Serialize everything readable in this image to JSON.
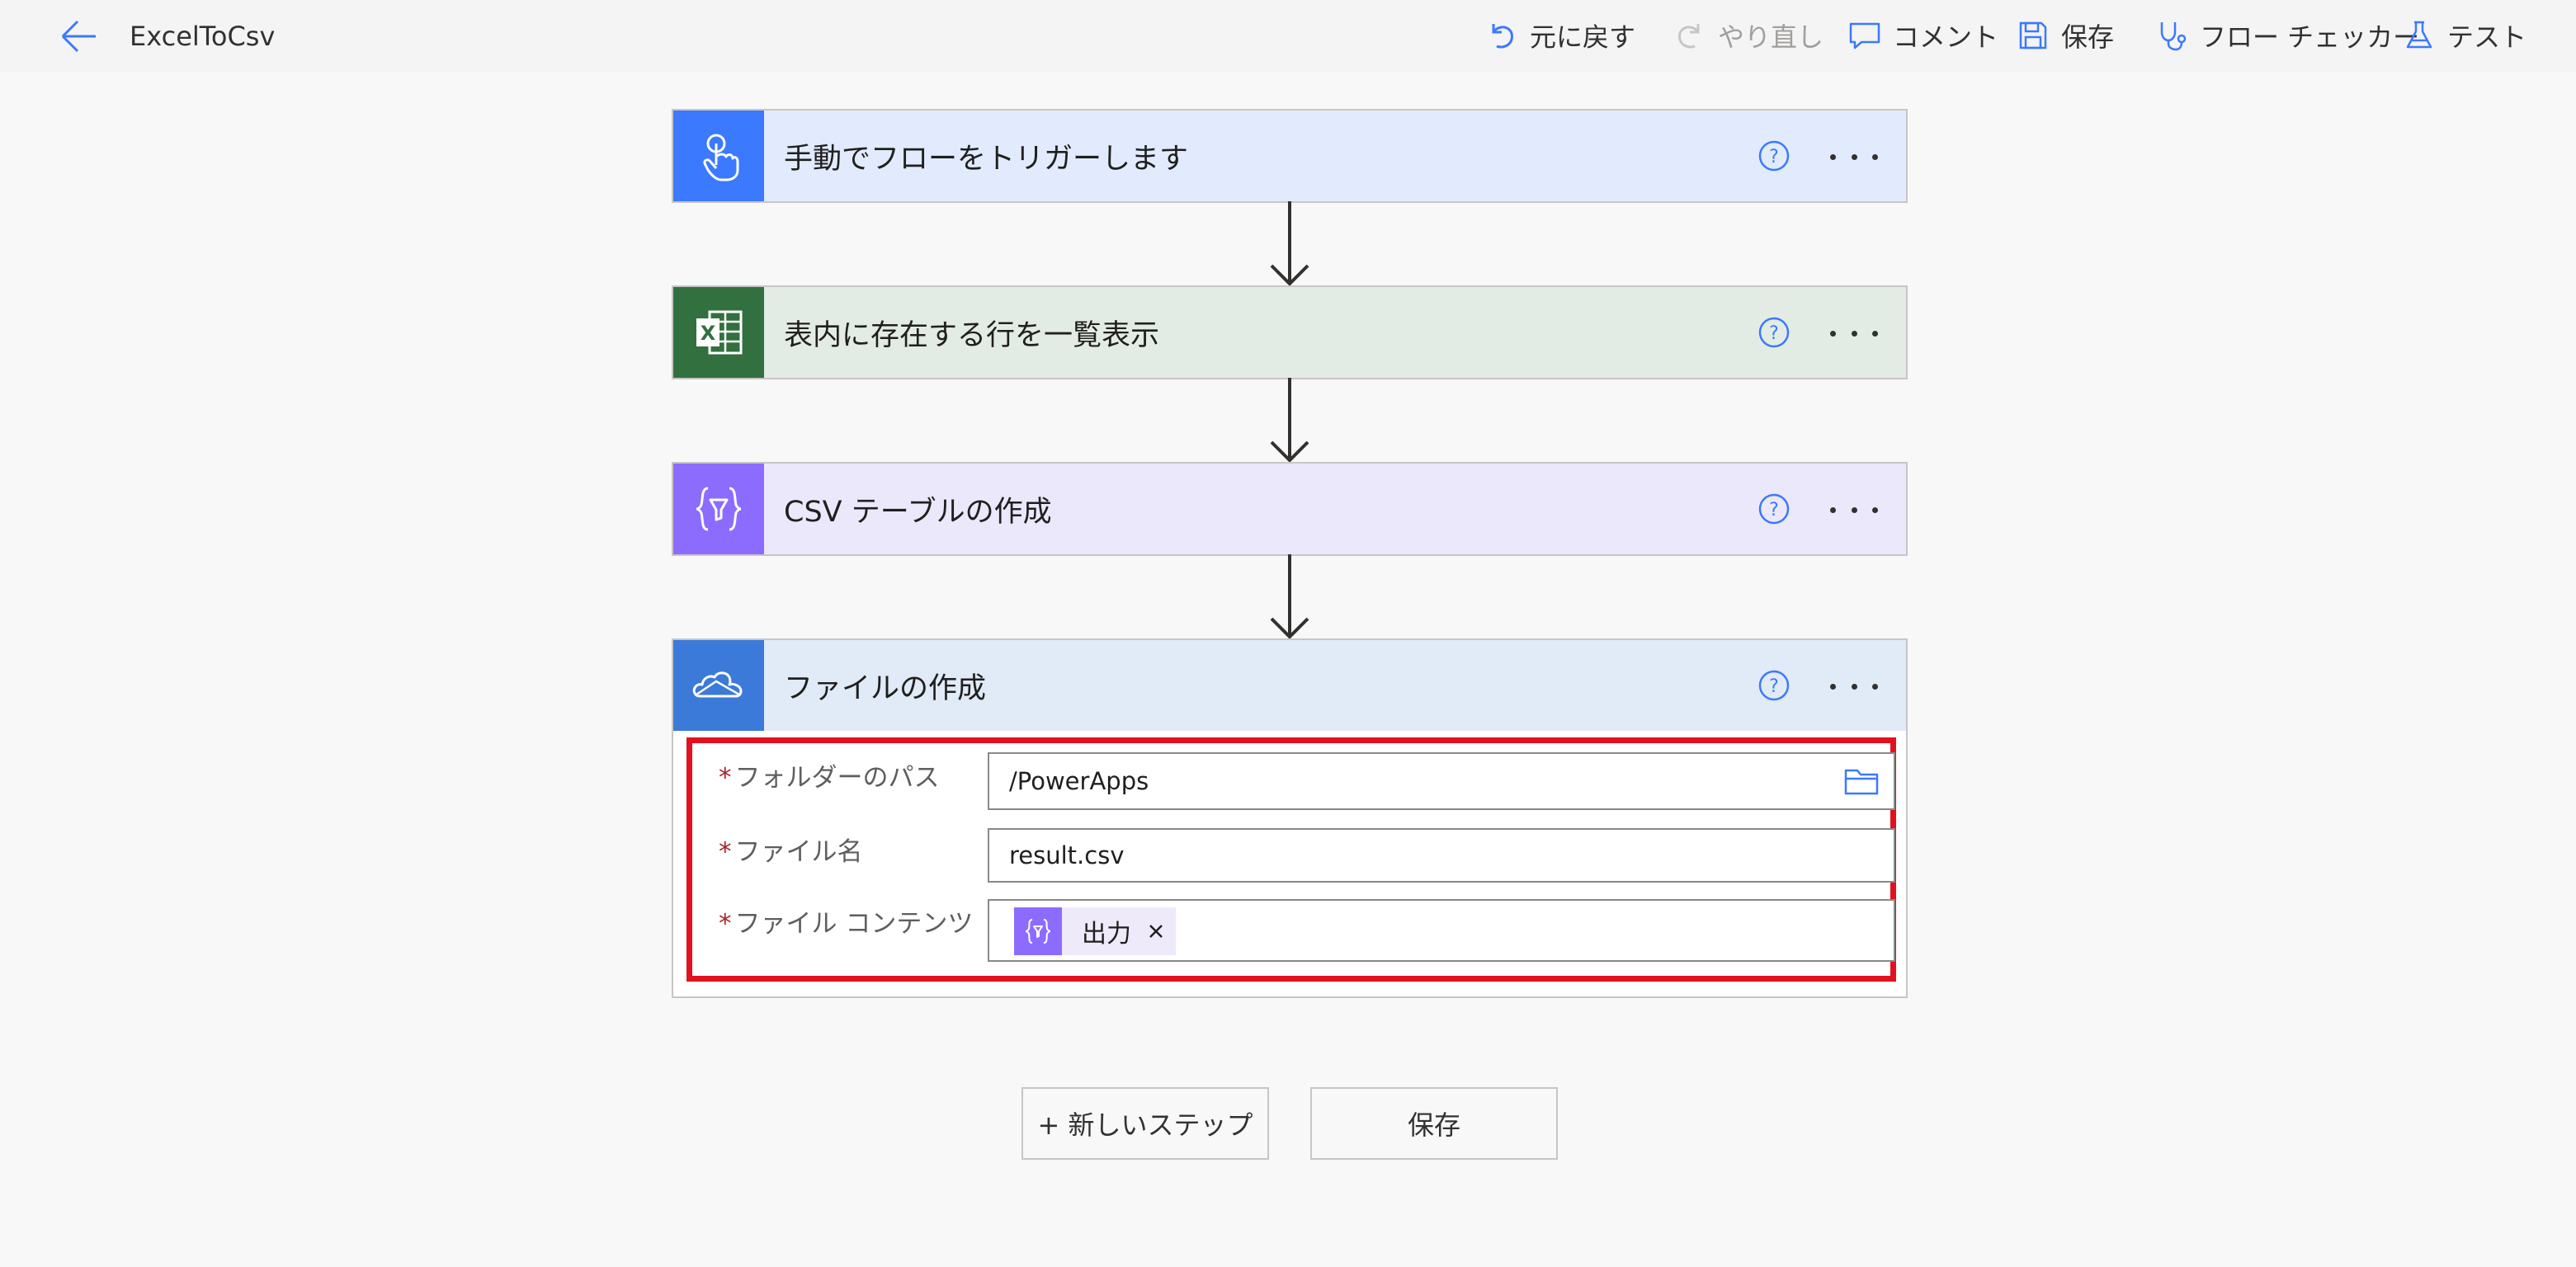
{
  "header": {
    "title": "ExcelToCsv",
    "commands": {
      "undo": "元に戻す",
      "redo": "やり直し",
      "comment": "コメント",
      "save": "保存",
      "checker": "フロー チェッカー",
      "test": "テスト"
    }
  },
  "steps": [
    {
      "title": "手動でフローをトリガーします",
      "icon": "touch-trigger-icon",
      "color": "#3b79ff",
      "bg": "#e1ebfd"
    },
    {
      "title": "表内に存在する行を一覧表示",
      "icon": "excel-icon",
      "color": "#327040",
      "bg": "#e3ece4"
    },
    {
      "title": "CSV テーブルの作成",
      "icon": "data-operation-icon",
      "color": "#8c6cff",
      "bg": "#ece8fb"
    },
    {
      "title": "ファイルの作成",
      "icon": "onedrive-icon",
      "color": "#3b7ad8",
      "bg": "#e1eaf7"
    }
  ],
  "create_file": {
    "folder_label": "フォルダーのパス",
    "folder_value": "/PowerApps",
    "filename_label": "ファイル名",
    "filename_value": "result.csv",
    "content_label": "ファイル コンテンツ",
    "content_token": "出力",
    "required_mark": "*"
  },
  "footer": {
    "new_step": "+ 新しいステップ",
    "save": "保存"
  },
  "colors": {
    "highlight": "#e3101e",
    "accent": "#3b79ff"
  }
}
